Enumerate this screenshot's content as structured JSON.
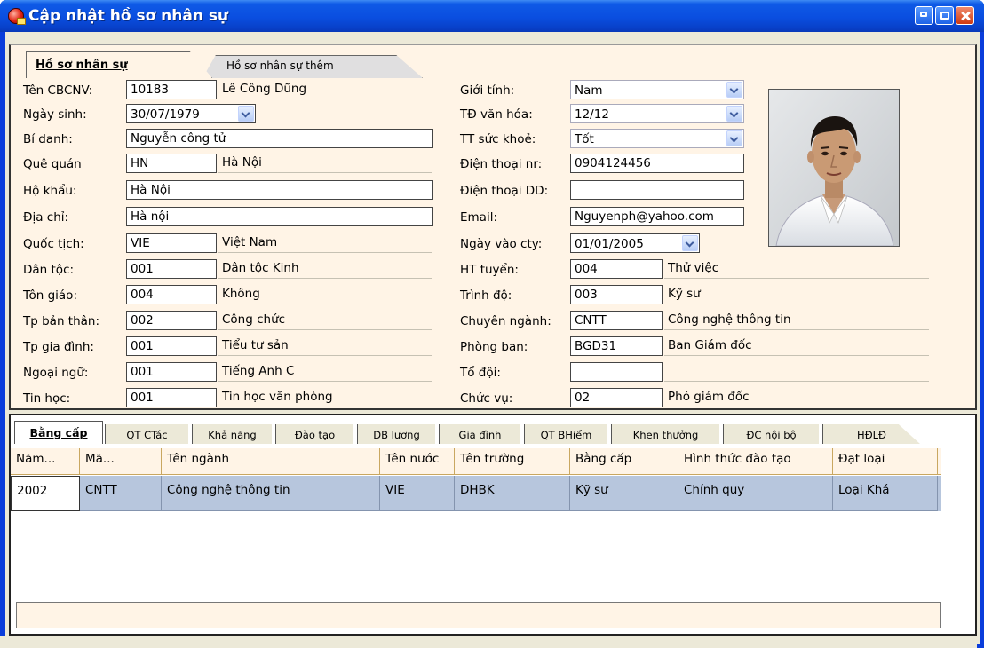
{
  "window": {
    "title": "Cập nhật hồ sơ nhân sự"
  },
  "tabs": [
    {
      "label": "Hồ sơ nhân sự",
      "active": true
    },
    {
      "label": "Hồ sơ nhân sự thêm",
      "active": false
    }
  ],
  "left": {
    "ten_cbcnv": {
      "label": "Tên CBCNV:",
      "code": "10183",
      "name": "Lê Công Dũng"
    },
    "ngay_sinh": {
      "label": "Ngày sinh:",
      "value": "30/07/1979"
    },
    "bi_danh": {
      "label": "Bí danh:",
      "value": "Nguyễn công tử"
    },
    "que_quan": {
      "label": "Quê quán",
      "code": "HN",
      "name": "Hà Nội"
    },
    "ho_khau": {
      "label": "Hộ khẩu:",
      "value": "Hà Nội"
    },
    "dia_chi": {
      "label": "Địa chỉ:",
      "value": "Hà nội"
    },
    "quoc_tich": {
      "label": "Quốc tịch:",
      "code": "VIE",
      "name": "Việt Nam"
    },
    "dan_toc": {
      "label": "Dân tộc:",
      "code": "001",
      "name": "Dân tộc Kinh"
    },
    "ton_giao": {
      "label": "Tôn giáo:",
      "code": "004",
      "name": "Không"
    },
    "tp_ban_than": {
      "label": "Tp bản thân:",
      "code": "002",
      "name": "Công chức"
    },
    "tp_gia_dinh": {
      "label": "Tp gia đình:",
      "code": "001",
      "name": "Tiểu tư sản"
    },
    "ngoai_ngu": {
      "label": "Ngoại ngữ:",
      "code": "001",
      "name": "Tiếng Anh C"
    },
    "tin_hoc": {
      "label": "Tin học:",
      "code": "001",
      "name": "Tin học văn phòng"
    }
  },
  "right": {
    "gioi_tinh": {
      "label": "Giới tính:",
      "value": "Nam"
    },
    "td_van_hoa": {
      "label": "TĐ văn hóa:",
      "value": "12/12"
    },
    "tt_suc_khoe": {
      "label": "TT sức khoẻ:",
      "value": "Tốt"
    },
    "dien_thoai_nr": {
      "label": "Điện thoại nr:",
      "value": "0904124456"
    },
    "dien_thoai_dd": {
      "label": "Điện thoại DD:",
      "value": ""
    },
    "email": {
      "label": "Email:",
      "value": "Nguyenph@yahoo.com"
    },
    "ngay_vao_cty": {
      "label": "Ngày vào cty:",
      "value": "01/01/2005"
    },
    "ht_tuyen": {
      "label": "HT tuyển:",
      "code": "004",
      "name": "Thử việc"
    },
    "trinh_do": {
      "label": "Trình độ:",
      "code": "003",
      "name": "Kỹ sư"
    },
    "chuyen_nganh": {
      "label": "Chuyên ngành:",
      "code": "CNTT",
      "name": "Công nghệ thông tin"
    },
    "phong_ban": {
      "label": "Phòng ban:",
      "code": "BGD31",
      "name": "Ban Giám đốc"
    },
    "to_doi": {
      "label": "Tổ đội:",
      "code": "",
      "name": ""
    },
    "chuc_vu": {
      "label": "Chức vụ:",
      "code": "02",
      "name": "Phó giám đốc"
    }
  },
  "bottom_tabs": [
    "Bằng cấp",
    "QT CTác",
    "Khả năng",
    "Đào tạo",
    "DB lương",
    "Gia đình",
    "QT BHiểm",
    "Khen thưởng",
    "ĐC nội bộ",
    "HĐLĐ"
  ],
  "grid": {
    "columns": [
      "Năm...",
      "Mã...",
      "Tên ngành",
      "Tên nước",
      "Tên trường",
      "Bằng cấp",
      "Hình thức đào tạo",
      "Đạt loại"
    ],
    "rows": [
      [
        "2002",
        "CNTT",
        "Công nghệ thông tin",
        "VIE",
        "DHBK",
        "Kỹ sư",
        "Chính quy",
        "Loại Khá"
      ]
    ]
  },
  "colors": {
    "titlebar": "#0a4ee0",
    "panel": "#fff4e6",
    "row_selected": "#b7c6dd"
  },
  "icons": [
    "app-icon",
    "minimize-icon",
    "maximize-icon",
    "close-icon",
    "chevron-down-icon"
  ]
}
